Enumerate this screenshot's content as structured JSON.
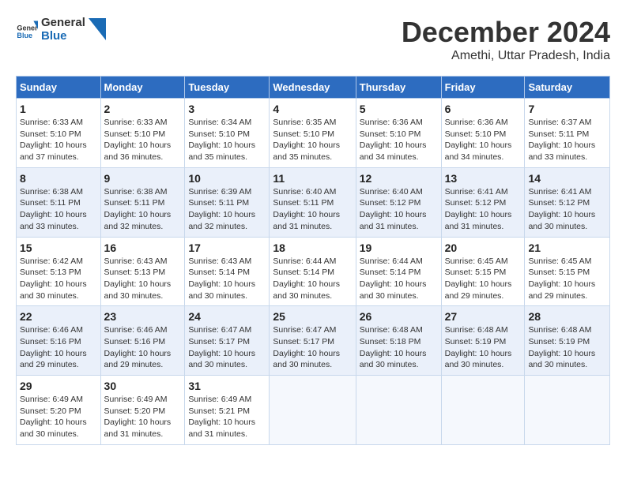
{
  "logo": {
    "line1": "General",
    "line2": "Blue"
  },
  "title": "December 2024",
  "location": "Amethi, Uttar Pradesh, India",
  "weekdays": [
    "Sunday",
    "Monday",
    "Tuesday",
    "Wednesday",
    "Thursday",
    "Friday",
    "Saturday"
  ],
  "weeks": [
    [
      {
        "day": "1",
        "sunrise": "6:33 AM",
        "sunset": "5:10 PM",
        "daylight": "10 hours and 37 minutes."
      },
      {
        "day": "2",
        "sunrise": "6:33 AM",
        "sunset": "5:10 PM",
        "daylight": "10 hours and 36 minutes."
      },
      {
        "day": "3",
        "sunrise": "6:34 AM",
        "sunset": "5:10 PM",
        "daylight": "10 hours and 35 minutes."
      },
      {
        "day": "4",
        "sunrise": "6:35 AM",
        "sunset": "5:10 PM",
        "daylight": "10 hours and 35 minutes."
      },
      {
        "day": "5",
        "sunrise": "6:36 AM",
        "sunset": "5:10 PM",
        "daylight": "10 hours and 34 minutes."
      },
      {
        "day": "6",
        "sunrise": "6:36 AM",
        "sunset": "5:10 PM",
        "daylight": "10 hours and 34 minutes."
      },
      {
        "day": "7",
        "sunrise": "6:37 AM",
        "sunset": "5:11 PM",
        "daylight": "10 hours and 33 minutes."
      }
    ],
    [
      {
        "day": "8",
        "sunrise": "6:38 AM",
        "sunset": "5:11 PM",
        "daylight": "10 hours and 33 minutes."
      },
      {
        "day": "9",
        "sunrise": "6:38 AM",
        "sunset": "5:11 PM",
        "daylight": "10 hours and 32 minutes."
      },
      {
        "day": "10",
        "sunrise": "6:39 AM",
        "sunset": "5:11 PM",
        "daylight": "10 hours and 32 minutes."
      },
      {
        "day": "11",
        "sunrise": "6:40 AM",
        "sunset": "5:11 PM",
        "daylight": "10 hours and 31 minutes."
      },
      {
        "day": "12",
        "sunrise": "6:40 AM",
        "sunset": "5:12 PM",
        "daylight": "10 hours and 31 minutes."
      },
      {
        "day": "13",
        "sunrise": "6:41 AM",
        "sunset": "5:12 PM",
        "daylight": "10 hours and 31 minutes."
      },
      {
        "day": "14",
        "sunrise": "6:41 AM",
        "sunset": "5:12 PM",
        "daylight": "10 hours and 30 minutes."
      }
    ],
    [
      {
        "day": "15",
        "sunrise": "6:42 AM",
        "sunset": "5:13 PM",
        "daylight": "10 hours and 30 minutes."
      },
      {
        "day": "16",
        "sunrise": "6:43 AM",
        "sunset": "5:13 PM",
        "daylight": "10 hours and 30 minutes."
      },
      {
        "day": "17",
        "sunrise": "6:43 AM",
        "sunset": "5:14 PM",
        "daylight": "10 hours and 30 minutes."
      },
      {
        "day": "18",
        "sunrise": "6:44 AM",
        "sunset": "5:14 PM",
        "daylight": "10 hours and 30 minutes."
      },
      {
        "day": "19",
        "sunrise": "6:44 AM",
        "sunset": "5:14 PM",
        "daylight": "10 hours and 30 minutes."
      },
      {
        "day": "20",
        "sunrise": "6:45 AM",
        "sunset": "5:15 PM",
        "daylight": "10 hours and 29 minutes."
      },
      {
        "day": "21",
        "sunrise": "6:45 AM",
        "sunset": "5:15 PM",
        "daylight": "10 hours and 29 minutes."
      }
    ],
    [
      {
        "day": "22",
        "sunrise": "6:46 AM",
        "sunset": "5:16 PM",
        "daylight": "10 hours and 29 minutes."
      },
      {
        "day": "23",
        "sunrise": "6:46 AM",
        "sunset": "5:16 PM",
        "daylight": "10 hours and 29 minutes."
      },
      {
        "day": "24",
        "sunrise": "6:47 AM",
        "sunset": "5:17 PM",
        "daylight": "10 hours and 30 minutes."
      },
      {
        "day": "25",
        "sunrise": "6:47 AM",
        "sunset": "5:17 PM",
        "daylight": "10 hours and 30 minutes."
      },
      {
        "day": "26",
        "sunrise": "6:48 AM",
        "sunset": "5:18 PM",
        "daylight": "10 hours and 30 minutes."
      },
      {
        "day": "27",
        "sunrise": "6:48 AM",
        "sunset": "5:19 PM",
        "daylight": "10 hours and 30 minutes."
      },
      {
        "day": "28",
        "sunrise": "6:48 AM",
        "sunset": "5:19 PM",
        "daylight": "10 hours and 30 minutes."
      }
    ],
    [
      {
        "day": "29",
        "sunrise": "6:49 AM",
        "sunset": "5:20 PM",
        "daylight": "10 hours and 30 minutes."
      },
      {
        "day": "30",
        "sunrise": "6:49 AM",
        "sunset": "5:20 PM",
        "daylight": "10 hours and 31 minutes."
      },
      {
        "day": "31",
        "sunrise": "6:49 AM",
        "sunset": "5:21 PM",
        "daylight": "10 hours and 31 minutes."
      },
      null,
      null,
      null,
      null
    ]
  ],
  "labels": {
    "sunrise": "Sunrise:",
    "sunset": "Sunset:",
    "daylight": "Daylight:"
  }
}
